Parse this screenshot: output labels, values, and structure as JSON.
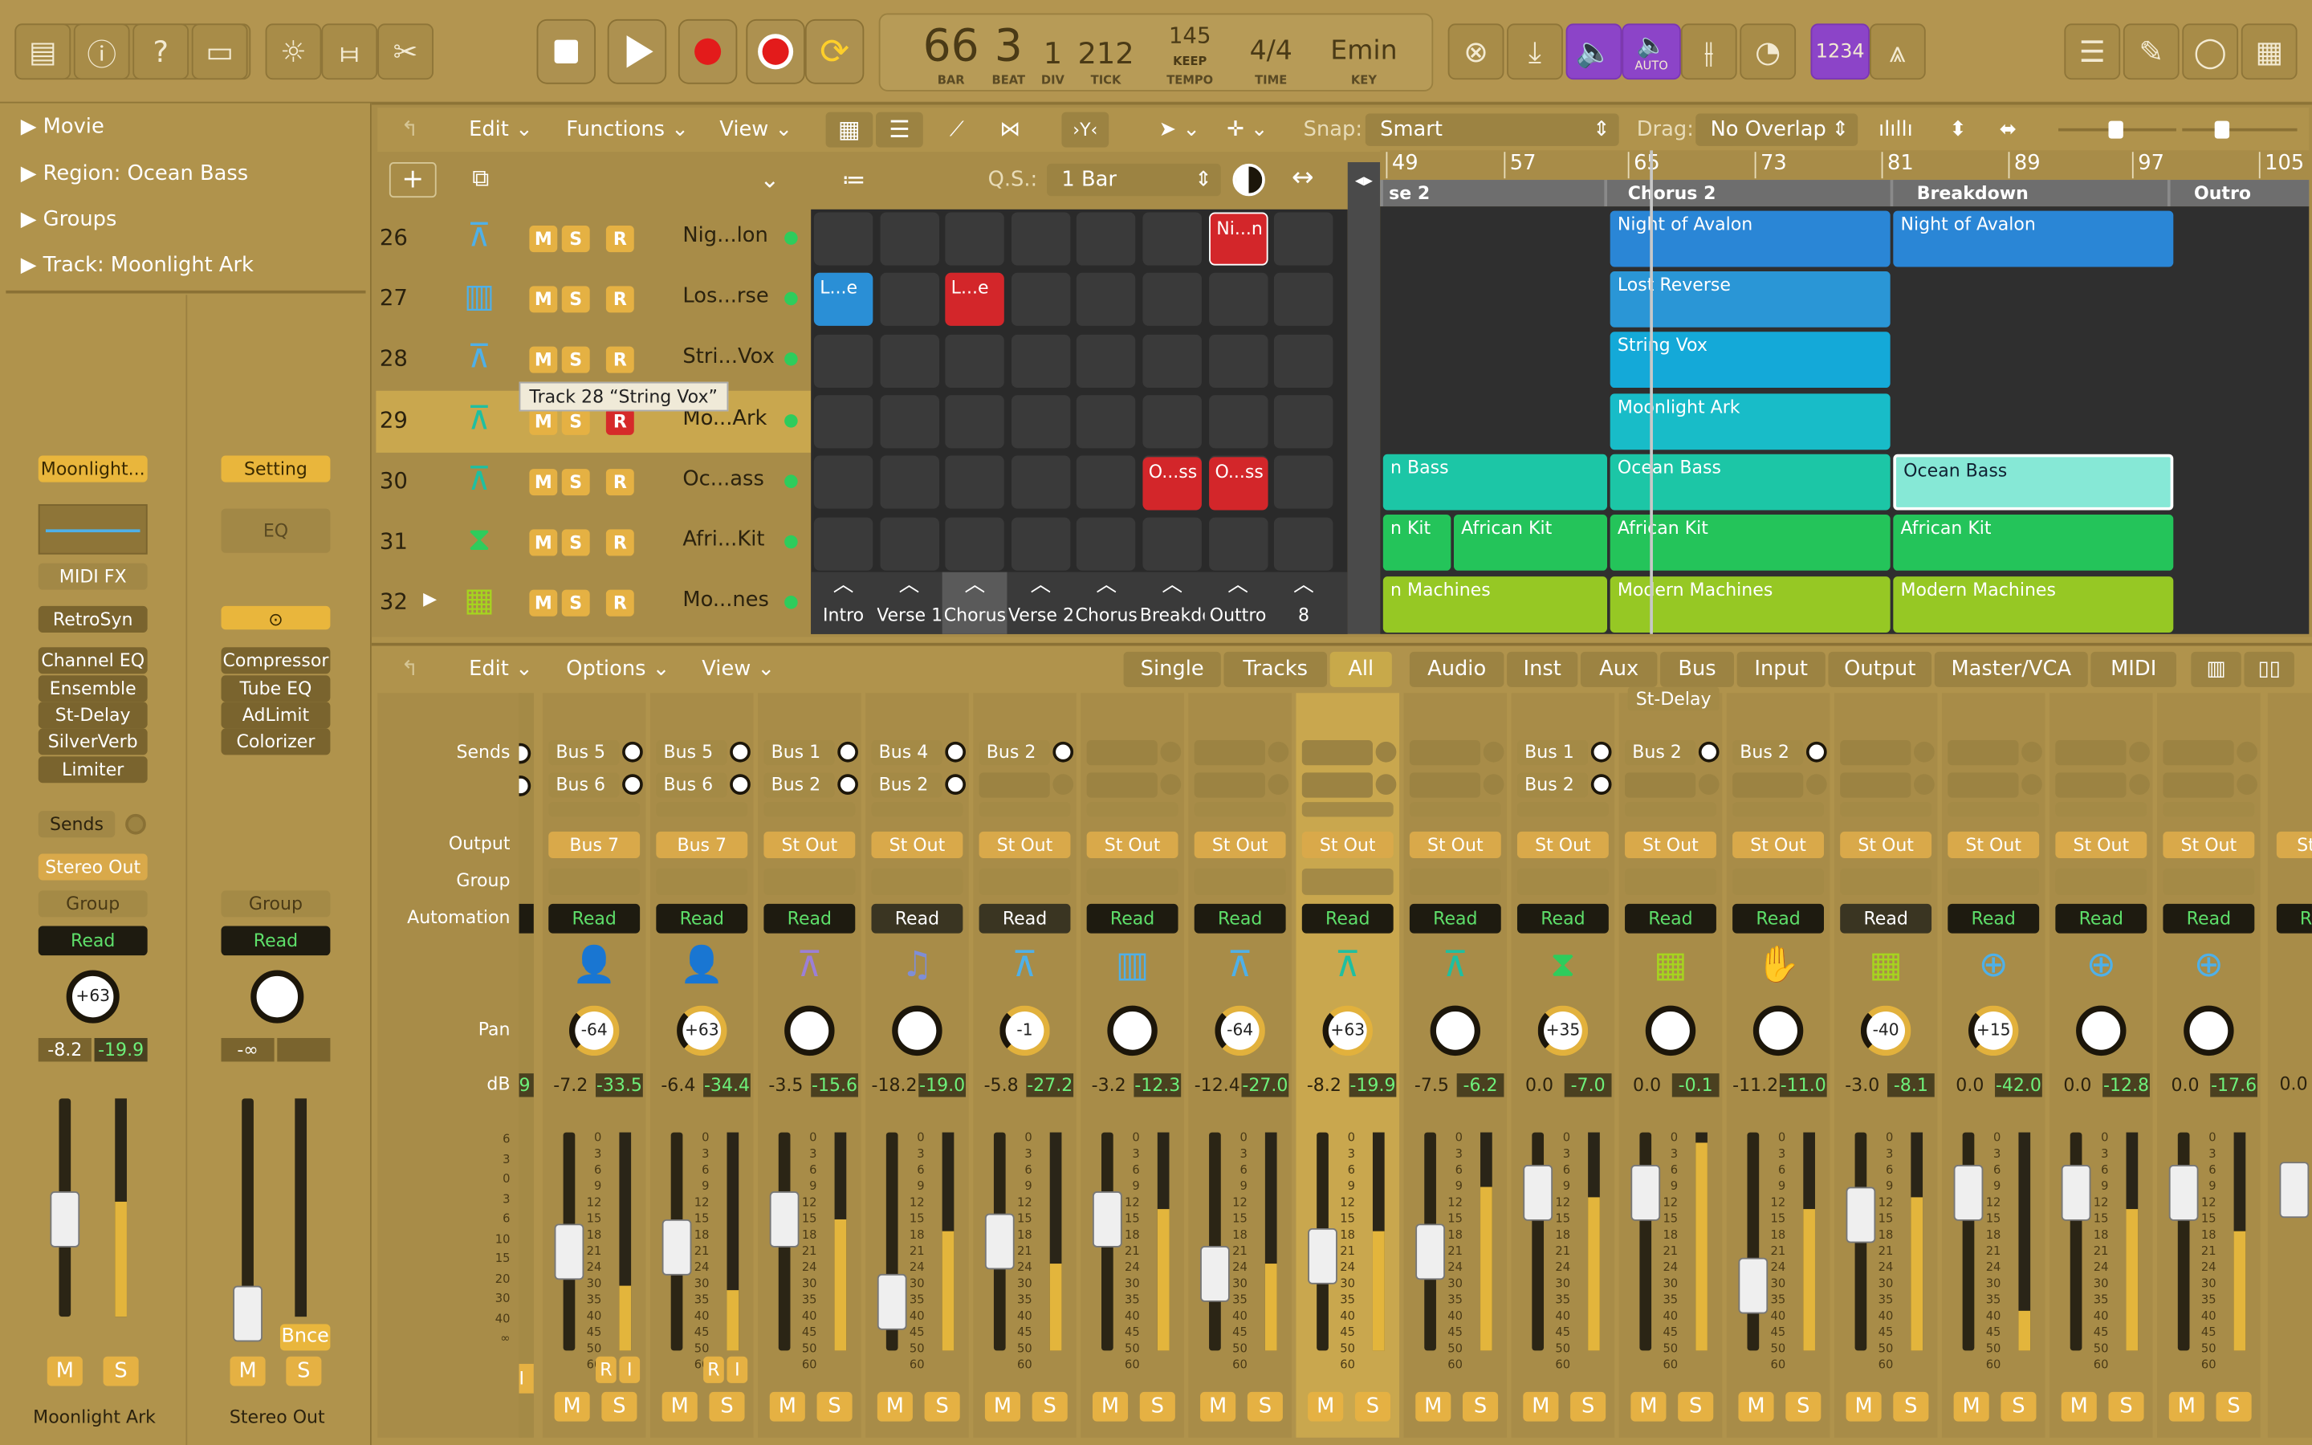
{
  "control_bar": {
    "lcd": {
      "bar": "66",
      "beat": "3",
      "div": "1",
      "tick": "212",
      "tempo": "145",
      "tempo_mode": "KEEP",
      "sig": "4/4",
      "key": "Emin",
      "labels": {
        "bar": "BAR",
        "beat": "BEAT",
        "div": "DIV",
        "tick": "TICK",
        "tempo": "TEMPO",
        "time": "TIME",
        "key": "KEY"
      }
    },
    "auto_label": "AUTO",
    "count_in": "1234"
  },
  "inspector": {
    "sections": [
      "Movie",
      "Region: Ocean Bass",
      "Groups",
      "Track:  Moonlight Ark"
    ],
    "left_strip": {
      "setting": "Moonlight...",
      "midi_fx": "MIDI FX",
      "instrument": "RetroSyn",
      "inserts": [
        "Channel EQ",
        "Ensemble",
        "St-Delay",
        "SilverVerb",
        "Limiter"
      ],
      "sends": "Sends",
      "output": "Stereo Out",
      "group": "Group",
      "automation": "Read",
      "pan": "+63",
      "db": "-8.2",
      "peak": "-19.9",
      "mute": "M",
      "solo": "S",
      "name": "Moonlight Ark"
    },
    "right_strip": {
      "setting": "Setting",
      "eq": "EQ",
      "inserts": [
        "Compressor",
        "Tube EQ",
        "AdLimit",
        "Colorizer"
      ],
      "group": "Group",
      "automation": "Read",
      "db": "-∞",
      "bounce": "Bnce",
      "mute": "M",
      "solo": "S",
      "name": "Stereo Out"
    }
  },
  "tracks_header": {
    "edit": "Edit",
    "functions": "Functions",
    "view": "View",
    "snap_label": "Snap:",
    "snap": "Smart",
    "drag_label": "Drag:",
    "drag": "No Overlap",
    "qs_label": "Q.S.:",
    "qs": "1 Bar"
  },
  "tracks": [
    {
      "num": "26",
      "name": "Nig...lon",
      "m": "M",
      "s": "S",
      "r": "R"
    },
    {
      "num": "27",
      "name": "Los...rse",
      "m": "M",
      "s": "S",
      "r": "R"
    },
    {
      "num": "28",
      "name": "Stri...Vox",
      "m": "M",
      "s": "S",
      "r": "R"
    },
    {
      "num": "29",
      "name": "Mo...Ark",
      "m": "M",
      "s": "S",
      "r": "R"
    },
    {
      "num": "30",
      "name": "Oc...ass",
      "m": "M",
      "s": "S",
      "r": "R"
    },
    {
      "num": "31",
      "name": "Afri...Kit",
      "m": "M",
      "s": "S",
      "r": "R"
    },
    {
      "num": "32",
      "name": "Mo...nes",
      "m": "M",
      "s": "S",
      "r": "R"
    }
  ],
  "tooltip": "Track 28 “String Vox”",
  "live_loops": {
    "clips": [
      {
        "label": "Ni...n"
      },
      {
        "label": "L...e"
      },
      {
        "label": "L...e"
      },
      {
        "label": "O...ss"
      },
      {
        "label": "O...ss"
      }
    ],
    "scenes": [
      "Intro",
      "Verse 1",
      "Chorus",
      "Verse 2",
      "Chorus",
      "Breakdo",
      "Outtro",
      "8"
    ]
  },
  "timeline": {
    "ruler": [
      "49",
      "57",
      "65",
      "73",
      "81",
      "89",
      "97",
      "105"
    ],
    "markers": [
      "se 2",
      "Chorus 2",
      "Breakdown",
      "Outro"
    ],
    "regions": [
      {
        "label": "Night of Avalon"
      },
      {
        "label": "Night of Avalon"
      },
      {
        "label": "Lost Reverse"
      },
      {
        "label": "String Vox"
      },
      {
        "label": "Moonlight Ark"
      },
      {
        "label": "n Bass"
      },
      {
        "label": "Ocean Bass"
      },
      {
        "label": "Ocean Bass"
      },
      {
        "label": "n Kit"
      },
      {
        "label": "African Kit"
      },
      {
        "label": "African Kit"
      },
      {
        "label": "African Kit"
      },
      {
        "label": "n Machines"
      },
      {
        "label": "Modern Machines"
      },
      {
        "label": "Modern Machines"
      }
    ]
  },
  "mixer_header": {
    "edit": "Edit",
    "options": "Options",
    "view": "View",
    "tabs": [
      "Single",
      "Tracks",
      "All",
      "Audio",
      "Inst",
      "Aux",
      "Bus",
      "Input",
      "Output",
      "Master/VCA",
      "MIDI"
    ]
  },
  "mixer_labels": {
    "sends": "Sends",
    "output": "Output",
    "group": "Group",
    "automation": "Automation",
    "pan": "Pan",
    "db": "dB"
  },
  "mixer_strips": [
    {
      "send1": "Bus 5",
      "send2": "Bus 6",
      "output": "Bus 7",
      "auto": "Read",
      "pan": "-64",
      "db": "-7.2",
      "peak": "-33.5",
      "fader": 0.45,
      "meter": 0.3
    },
    {
      "send1": "Bus 5",
      "send2": "Bus 6",
      "output": "Bus 7",
      "auto": "Read",
      "pan": "+63",
      "db": "-6.4",
      "peak": "-34.4",
      "fader": 0.47,
      "meter": 0.28
    },
    {
      "send1": "Bus 1",
      "send2": "Bus 2",
      "output": "St Out",
      "auto": "Read",
      "pan": "",
      "db": "-3.5",
      "peak": "-15.6",
      "fader": 0.6,
      "meter": 0.6
    },
    {
      "send1": "Bus 4",
      "send2": "Bus 2",
      "output": "St Out",
      "auto": "Read",
      "pan": "",
      "db": "-18.2",
      "peak": "-19.0",
      "fader": 0.22,
      "meter": 0.55
    },
    {
      "send1": "Bus 2",
      "send2": "",
      "output": "St Out",
      "auto": "Read",
      "pan": "-1",
      "db": "-5.8",
      "peak": "-27.2",
      "fader": 0.5,
      "meter": 0.4
    },
    {
      "send1": "",
      "send2": "",
      "output": "St Out",
      "auto": "Read",
      "pan": "",
      "db": "-3.2",
      "peak": "-12.3",
      "fader": 0.6,
      "meter": 0.65
    },
    {
      "send1": "",
      "send2": "",
      "output": "St Out",
      "auto": "Read",
      "pan": "-64",
      "db": "-12.4",
      "peak": "-27.0",
      "fader": 0.35,
      "meter": 0.4
    },
    {
      "send1": "",
      "send2": "",
      "output": "St Out",
      "auto": "Read",
      "pan": "+63",
      "db": "-8.2",
      "peak": "-19.9",
      "fader": 0.43,
      "meter": 0.55
    },
    {
      "send1": "",
      "send2": "",
      "output": "St Out",
      "auto": "Read",
      "pan": "",
      "db": "-7.5",
      "peak": "-6.2",
      "fader": 0.45,
      "meter": 0.75
    },
    {
      "send1": "Bus 1",
      "send2": "Bus 2",
      "output": "St Out",
      "auto": "Read",
      "pan": "+35",
      "db": "0.0",
      "peak": "-7.0",
      "fader": 0.72,
      "meter": 0.7
    },
    {
      "send1": "Bus 2",
      "send2": "",
      "output": "St Out",
      "auto": "Read",
      "pan": "",
      "db": "0.0",
      "peak": "-0.1",
      "fader": 0.72,
      "meter": 0.95
    },
    {
      "send1": "Bus 2",
      "send2": "",
      "output": "St Out",
      "auto": "Read",
      "pan": "",
      "db": "-11.2",
      "peak": "-11.0",
      "fader": 0.3,
      "meter": 0.65
    },
    {
      "send1": "",
      "send2": "",
      "output": "St Out",
      "auto": "Read",
      "pan": "-40",
      "db": "-3.0",
      "peak": "-8.1",
      "fader": 0.62,
      "meter": 0.7
    },
    {
      "send1": "",
      "send2": "",
      "output": "St Out",
      "auto": "Read",
      "pan": "+15",
      "db": "0.0",
      "peak": "-42.0",
      "fader": 0.72,
      "meter": 0.18
    },
    {
      "send1": "",
      "send2": "",
      "output": "St Out",
      "auto": "Read",
      "pan": "",
      "db": "0.0",
      "peak": "-12.8",
      "fader": 0.72,
      "meter": 0.65
    },
    {
      "send1": "",
      "send2": "",
      "output": "St Out",
      "auto": "Read",
      "pan": "",
      "db": "0.0",
      "peak": "-17.6",
      "fader": 0.72,
      "meter": 0.55
    }
  ],
  "mixer_extra": {
    "top_label": "St-Delay",
    "mute": "M",
    "solo": "S",
    "r": "R",
    "i": "I",
    "trunc_db": "0.0",
    "trunc_peak": "9",
    "trunc_out": "St",
    "trunc_auto": "R"
  }
}
